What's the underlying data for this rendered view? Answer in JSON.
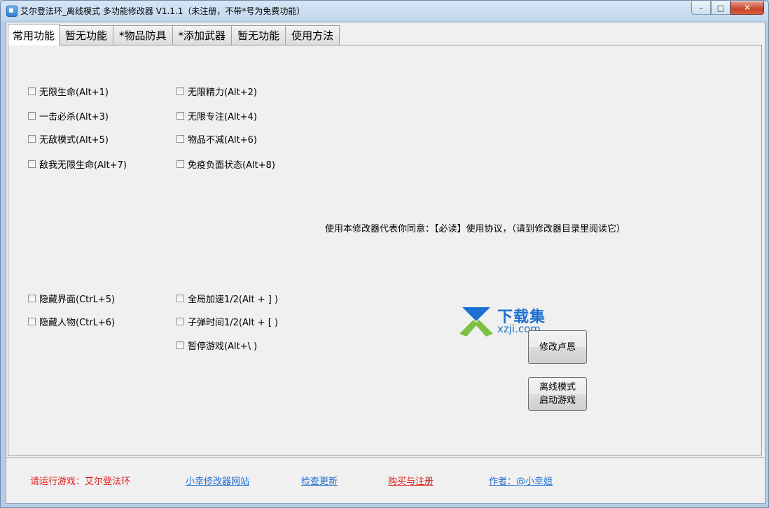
{
  "window": {
    "title": "艾尔登法环_离线模式 多功能修改器  V1.1.1（未注册，不带*号为免费功能）",
    "controls": {
      "minimize": "–",
      "maximize": "□",
      "close": "✕"
    }
  },
  "tabs": [
    {
      "label": "常用功能",
      "active": true
    },
    {
      "label": "暂无功能"
    },
    {
      "label": "*物品防具"
    },
    {
      "label": "*添加武器"
    },
    {
      "label": "暂无功能"
    },
    {
      "label": "使用方法"
    }
  ],
  "checkboxes_top": [
    {
      "label": "无限生命(Alt+1)",
      "checked": false
    },
    {
      "label": "无限精力(Alt+2)",
      "checked": false
    },
    {
      "label": "一击必杀(Alt+3)",
      "checked": false
    },
    {
      "label": "无限专注(Alt+4)",
      "checked": false
    },
    {
      "label": "无敌模式(Alt+5)",
      "checked": false
    },
    {
      "label": "物品不减(Alt+6)",
      "checked": false
    },
    {
      "label": "敌我无限生命(Alt+7)",
      "checked": false
    },
    {
      "label": "免疫负面状态(Alt+8)",
      "checked": false
    }
  ],
  "checkboxes_bottom": [
    {
      "label": "隐藏界面(CtrL+5)",
      "checked": false
    },
    {
      "label": "全局加速1/2(Alt + ] )",
      "checked": false
    },
    {
      "label": "隐藏人物(CtrL+6)",
      "checked": false
    },
    {
      "label": "子弹时间1/2(Alt + [ )",
      "checked": false
    },
    {
      "label": "暂停游戏(Alt+\\ )",
      "checked": false
    }
  ],
  "agreement_text": "使用本修改器代表你同意：【必读】使用协议，（请到修改器目录里阅读它）",
  "buttons": {
    "modify_runes": "修改卢恩",
    "offline_launch_line1": "离线模式",
    "offline_launch_line2": "启动游戏"
  },
  "watermark": {
    "line1": "下载集",
    "line2": "xzji.com"
  },
  "footer": {
    "run_game": "请运行游戏：艾尔登法环",
    "website": "小幸修改器网站",
    "check_update": "检查更新",
    "buy_register": "购买与注册",
    "author": "作者：@小幸姐"
  },
  "colors": {
    "link": "#1f6fd0",
    "warning": "#e0201c"
  }
}
